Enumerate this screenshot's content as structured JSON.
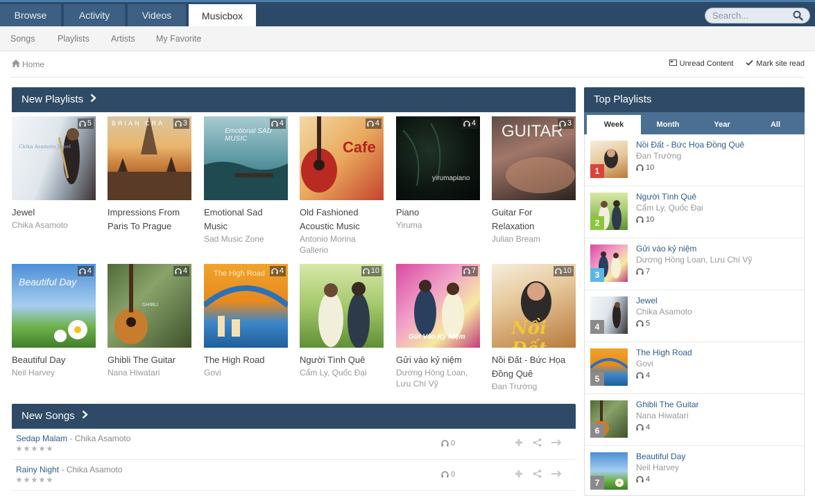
{
  "top_tabs": [
    "Browse",
    "Activity",
    "Videos",
    "Musicbox"
  ],
  "search": {
    "placeholder": "Search..."
  },
  "sub_nav": [
    "Songs",
    "Playlists",
    "Artists",
    "My Favorite"
  ],
  "breadcrumb": {
    "home": "Home"
  },
  "actions": {
    "unread": "Unread Content",
    "mark_read": "Mark site read"
  },
  "new_playlists": {
    "heading": "New Playlists",
    "items": [
      {
        "title": "Jewel",
        "artist": "Chika Asamoto",
        "count": "5",
        "cover_text": "Chika Asamoto Jewel"
      },
      {
        "title": "Impressions From Paris To Prague",
        "artist": "",
        "count": "3",
        "cover_text": "BRIAN CRA"
      },
      {
        "title": "Emotional Sad Music",
        "artist": "Sad Music Zone",
        "count": "4",
        "cover_text": "Emotional SAD MUSIC"
      },
      {
        "title": "Old Fashioned Acoustic Music",
        "artist": "Antonio Morina Gallerio",
        "count": "4",
        "cover_text": "Cafe"
      },
      {
        "title": "Piano",
        "artist": "Yiruma",
        "count": "4",
        "cover_text": "yirumapiano"
      },
      {
        "title": "Guitar For Relaxation",
        "artist": "Julian Bream",
        "count": "3",
        "cover_text": "GUITAR"
      },
      {
        "title": "Beautiful Day",
        "artist": "Neil Harvey",
        "count": "4",
        "cover_text": "Beautiful Day"
      },
      {
        "title": "Ghibli The Guitar",
        "artist": "Nana Hiwatari",
        "count": "4",
        "cover_text": "GHIBLI"
      },
      {
        "title": "The High Road",
        "artist": "Govi",
        "count": "4",
        "cover_text": "The High Road"
      },
      {
        "title": "Người Tình Quê",
        "artist": "Cẩm Ly, Quốc Đại",
        "count": "10",
        "cover_text": ""
      },
      {
        "title": "Gửi vào kỷ niệm",
        "artist": "Dương Hồng Loan, Lưu Chí Vỹ",
        "count": "7",
        "cover_text": "Gửi Vào Kỷ Niệm"
      },
      {
        "title": "Nồi Đất - Bức Họa Đồng Quê",
        "artist": "Đan Trường",
        "count": "10",
        "cover_text": "Nồi Đất"
      }
    ]
  },
  "new_songs": {
    "heading": "New Songs",
    "items": [
      {
        "title": "Sedap Malam",
        "artist": "Chika Asamoto",
        "plays": "0"
      },
      {
        "title": "Rainy Night",
        "artist": "Chika Asamoto",
        "plays": "0"
      }
    ]
  },
  "top_playlists": {
    "heading": "Top Playlists",
    "tabs": [
      "Week",
      "Month",
      "Year",
      "All"
    ],
    "active_tab": "Week",
    "items": [
      {
        "rank": "1",
        "title": "Nồi Đất - Bức Họa Đồng Quê",
        "artist": "Đan Trường",
        "plays": "10",
        "rank_color": "#d9433b"
      },
      {
        "rank": "2",
        "title": "Người Tình Quê",
        "artist": "Cẩm Ly, Quốc Đại",
        "plays": "10",
        "rank_color": "#8cc63f"
      },
      {
        "rank": "3",
        "title": "Gửi vào kỷ niệm",
        "artist": "Dương Hồng Loan, Lưu Chí Vỹ",
        "plays": "7",
        "rank_color": "#5bb8e6"
      },
      {
        "rank": "4",
        "title": "Jewel",
        "artist": "Chika Asamoto",
        "plays": "5",
        "rank_color": "#8a8a8a"
      },
      {
        "rank": "5",
        "title": "The High Road",
        "artist": "Govi",
        "plays": "4",
        "rank_color": "#8a8a8a"
      },
      {
        "rank": "6",
        "title": "Ghibli The Guitar",
        "artist": "Nana Hiwatari",
        "plays": "4",
        "rank_color": "#8a8a8a"
      },
      {
        "rank": "7",
        "title": "Beautiful Day",
        "artist": "Neil Harvey",
        "plays": "4",
        "rank_color": "#8a8a8a"
      }
    ]
  },
  "colors": {
    "header": "#2e4a66",
    "topbar": "#2c4a68",
    "link": "#2e5b8a"
  }
}
